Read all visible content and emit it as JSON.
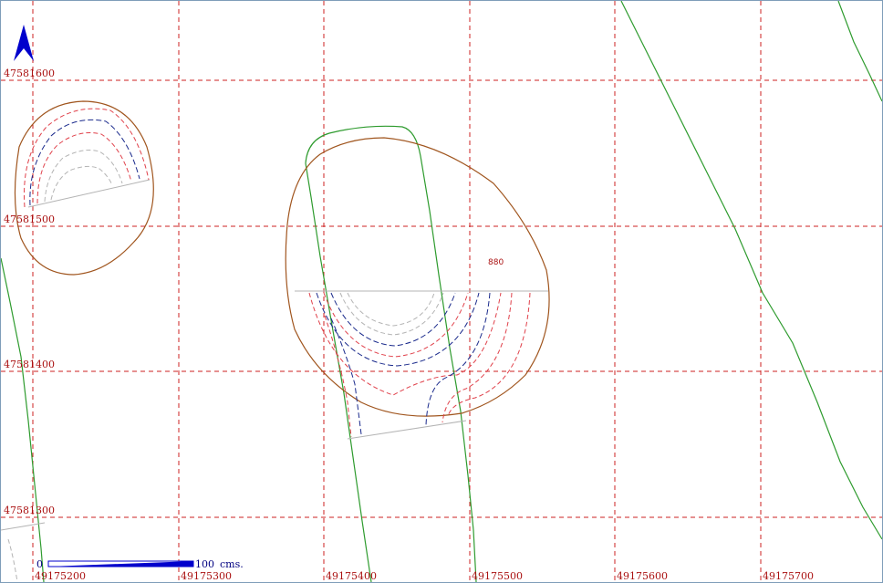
{
  "map": {
    "north_arrow_icon": "north-arrow-icon",
    "grid": {
      "color": "#cc2222",
      "x_labels": [
        "49175200",
        "49175300",
        "49175400",
        "49175500",
        "49175600",
        "49175700"
      ],
      "y_labels": [
        "47581600",
        "47581500",
        "47581400",
        "47581300"
      ]
    },
    "contour_value_label": "880",
    "scale_bar": {
      "start_label": "0",
      "end_label": "100",
      "unit_label": "cms."
    },
    "colors": {
      "grid": "#cc2222",
      "label_text": "#aa1111",
      "boundary": "#a0551e",
      "road": "#2e9b2e",
      "contour_blue": "#1a2a8c",
      "contour_red": "#e0404a",
      "contour_grey": "#b4b4b4",
      "scale_bar": "#0000cc",
      "north_arrow": "#0000cc"
    }
  }
}
